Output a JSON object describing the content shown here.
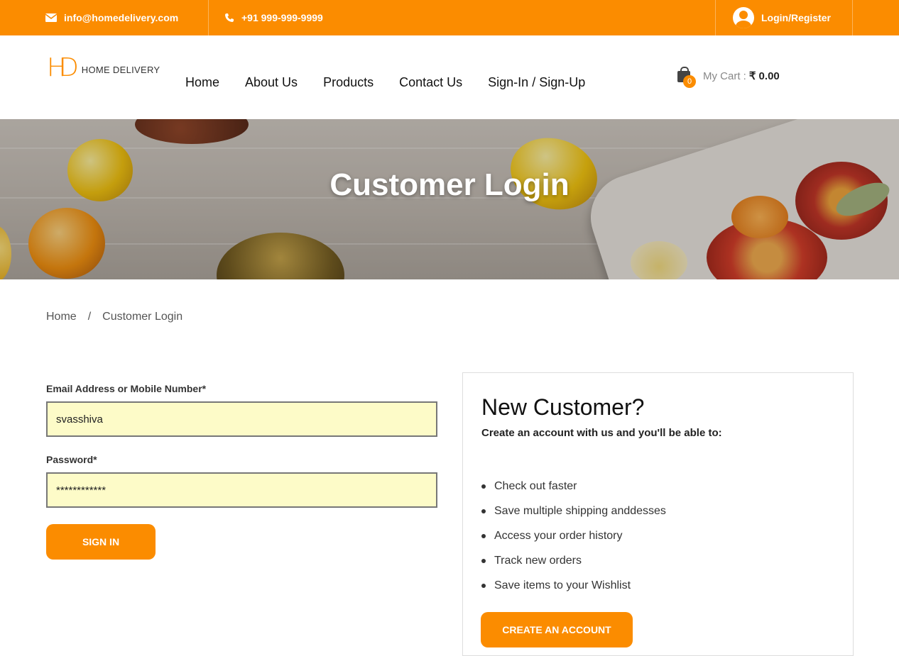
{
  "topbar": {
    "email": "info@homedelivery.com",
    "phone": "+91 999-999-9999",
    "login_register": "Login/Register"
  },
  "header": {
    "logo_mark": "HD",
    "logo_text": "HOME DELIVERY",
    "nav": [
      "Home",
      "About Us",
      "Products",
      "Contact Us",
      "Sign-In / Sign-Up"
    ],
    "cart": {
      "count": "0",
      "label": "My Cart :",
      "amount": "₹ 0.00"
    }
  },
  "banner": {
    "title": "Customer Login"
  },
  "breadcrumb": {
    "home": "Home",
    "separator": "/",
    "current": "Customer Login"
  },
  "login_form": {
    "email_label": "Email Address or Mobile Number*",
    "email_value": "svasshiva",
    "password_label": "Password*",
    "password_value": "************",
    "submit_label": "SIGN IN"
  },
  "new_customer": {
    "title": "New Customer?",
    "subtitle": "Create an account with us and you'll be able to:",
    "benefits": [
      "Check out faster",
      "Save multiple shipping anddesses",
      "Access your order history",
      "Track new orders",
      "Save items to your Wishlist"
    ],
    "create_label": "CREATE AN ACCOUNT"
  },
  "colors": {
    "accent": "#fb8c00",
    "field_bg": "#fdfbc8"
  }
}
